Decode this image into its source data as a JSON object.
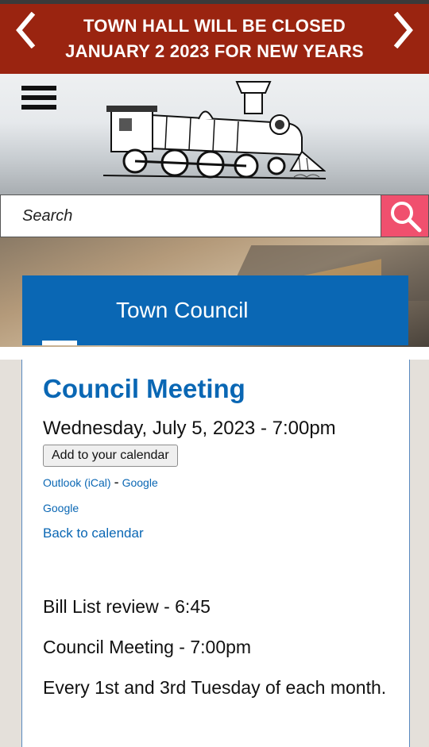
{
  "banner": {
    "line1": "TOWN HALL WILL BE CLOSED",
    "line2": "JANUARY 2 2023 FOR NEW YEARS",
    "prev_icon": "chevron-left-icon",
    "next_icon": "chevron-right-icon"
  },
  "header": {
    "menu_icon": "hamburger-menu-icon",
    "logo": "locomotive-logo"
  },
  "search": {
    "placeholder": "Search",
    "icon": "search-icon"
  },
  "section": {
    "title": "Town Council"
  },
  "event": {
    "title": "Council Meeting",
    "datetime": "Wednesday, July 5, 2023 - 7:00pm",
    "calendar_button": "Add to your calendar",
    "link_outlook": "Outlook (iCal)",
    "link_separator": "-",
    "link_google": "Google",
    "link_google2": "Google",
    "back_link": "Back to calendar"
  },
  "description": {
    "p1": "Bill List review - 6:45",
    "p2": "Council Meeting - 7:00pm",
    "p3": "Every 1st and 3rd Tuesday of each month."
  },
  "colors": {
    "banner": "#9a2410",
    "accent": "#0a67b4",
    "search_button": "#f0506e"
  }
}
